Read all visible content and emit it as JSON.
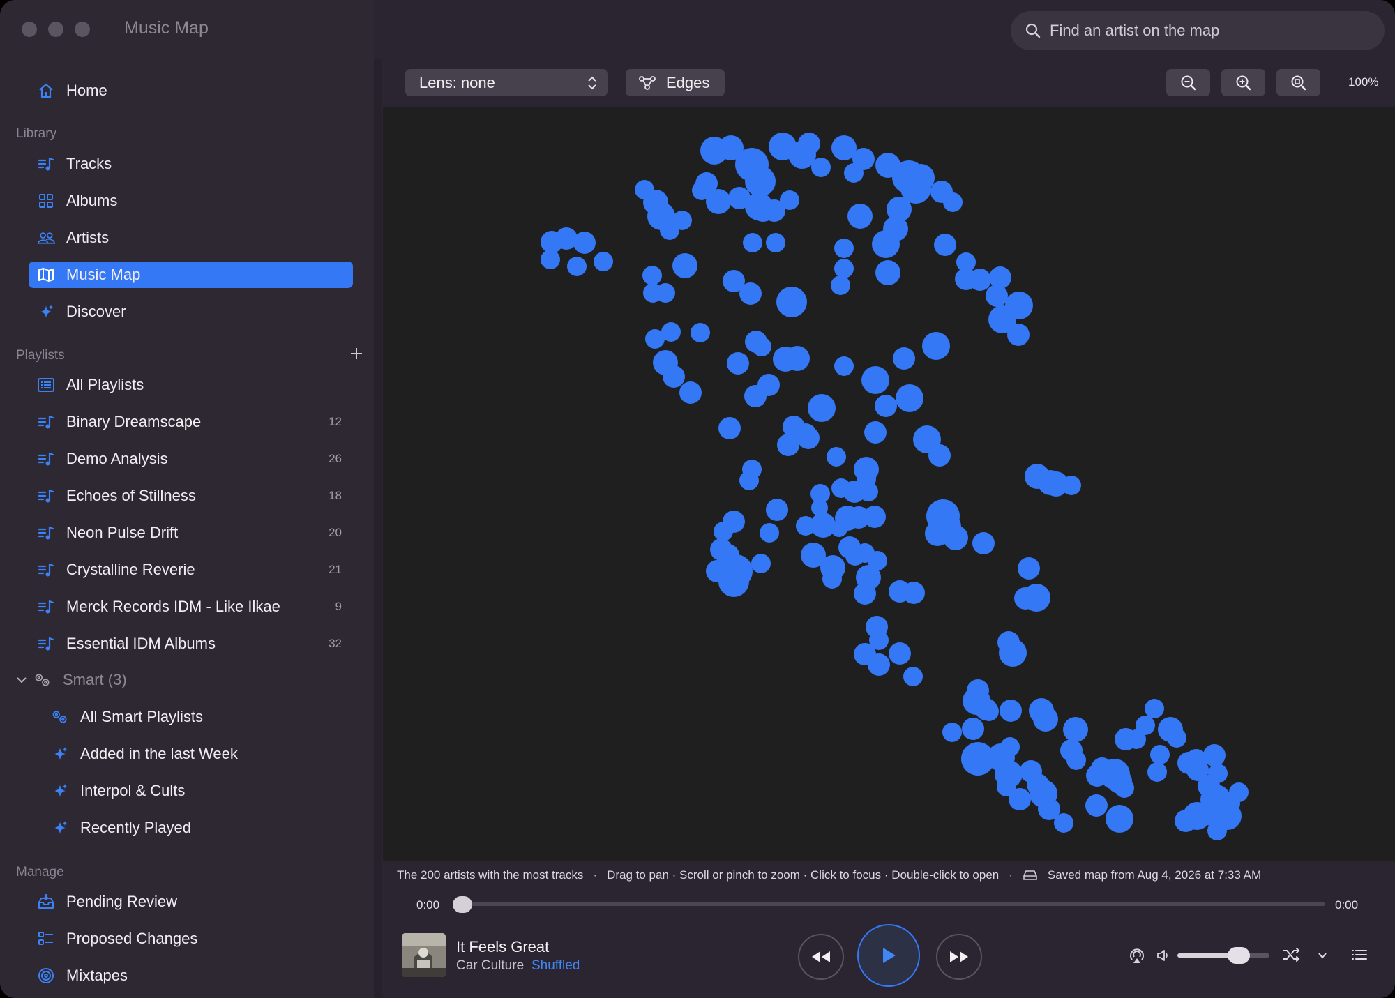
{
  "window": {
    "title": "Music Map"
  },
  "sidebar": {
    "home": "Home",
    "library_header": "Library",
    "library": [
      {
        "label": "Tracks",
        "icon": "tracks-icon"
      },
      {
        "label": "Albums",
        "icon": "albums-icon"
      },
      {
        "label": "Artists",
        "icon": "artists-icon"
      },
      {
        "label": "Music Map",
        "icon": "map-icon",
        "active": true
      },
      {
        "label": "Discover",
        "icon": "sparkle-icon"
      }
    ],
    "playlists_header": "Playlists",
    "playlists": [
      {
        "label": "All Playlists",
        "count": ""
      },
      {
        "label": "Binary Dreamscape",
        "count": "12"
      },
      {
        "label": "Demo Analysis",
        "count": "26"
      },
      {
        "label": "Echoes of Stillness",
        "count": "18"
      },
      {
        "label": "Neon Pulse Drift",
        "count": "20"
      },
      {
        "label": "Crystalline Reverie",
        "count": "21"
      },
      {
        "label": "Merck Records IDM - Like Ilkae",
        "count": "9"
      },
      {
        "label": "Essential IDM Albums",
        "count": "32"
      }
    ],
    "smart_group": "Smart (3)",
    "smart": [
      {
        "label": "All Smart Playlists"
      },
      {
        "label": "Added in the last Week"
      },
      {
        "label": "Interpol & Cults"
      },
      {
        "label": "Recently Played"
      }
    ],
    "manage_header": "Manage",
    "manage": [
      {
        "label": "Pending Review"
      },
      {
        "label": "Proposed Changes"
      },
      {
        "label": "Mixtapes"
      }
    ]
  },
  "search": {
    "placeholder": "Find an artist on the map"
  },
  "toolbar": {
    "lens_label": "Lens: none",
    "edges_label": "Edges",
    "zoom_level": "100%"
  },
  "status_bar": {
    "summary": "The 200 artists with the most tracks",
    "hint": "Drag to pan · Scroll or pinch to zoom · Click to focus · Double-click to open",
    "saved": "Saved map from Aug 4, 2026 at 7:33 AM"
  },
  "player": {
    "time_elapsed": "0:00",
    "time_total": "0:00",
    "progress": 0,
    "title": "It Feels Great",
    "artist": "Car Culture",
    "shuffle_label": "Shuffled",
    "volume": 0.65
  },
  "colors": {
    "accent": "#3478f6",
    "node": "#3478f6"
  }
}
